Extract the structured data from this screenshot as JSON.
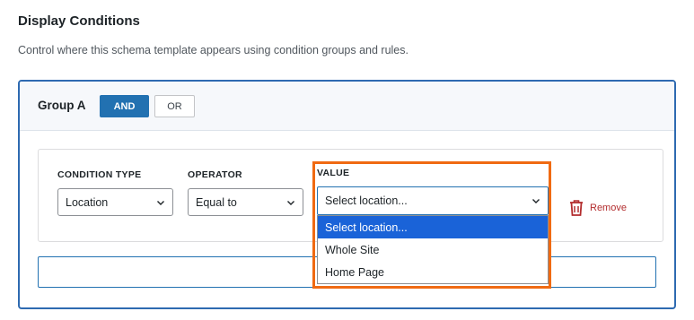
{
  "section": {
    "title": "Display Conditions",
    "description": "Control where this schema template appears using condition groups and rules."
  },
  "group": {
    "name": "Group A",
    "logic_and": "AND",
    "logic_or": "OR",
    "active_logic": "AND"
  },
  "condition": {
    "type_label": "CONDITION TYPE",
    "type_value": "Location",
    "operator_label": "OPERATOR",
    "operator_value": "Equal to",
    "value_label": "VALUE",
    "value_value": "Select location...",
    "remove_label": "Remove"
  },
  "dropdown": {
    "options": [
      "Select location...",
      "Whole Site",
      "Home Page"
    ],
    "highlighted": "Select location..."
  },
  "colors": {
    "accent": "#2271b1",
    "highlight_outline": "#f06a12",
    "remove": "#b32d2e",
    "dropdown_selected": "#1a63d8"
  },
  "icons": {
    "remove": "trash-icon",
    "select_arrow": "chevron-down-icon"
  }
}
